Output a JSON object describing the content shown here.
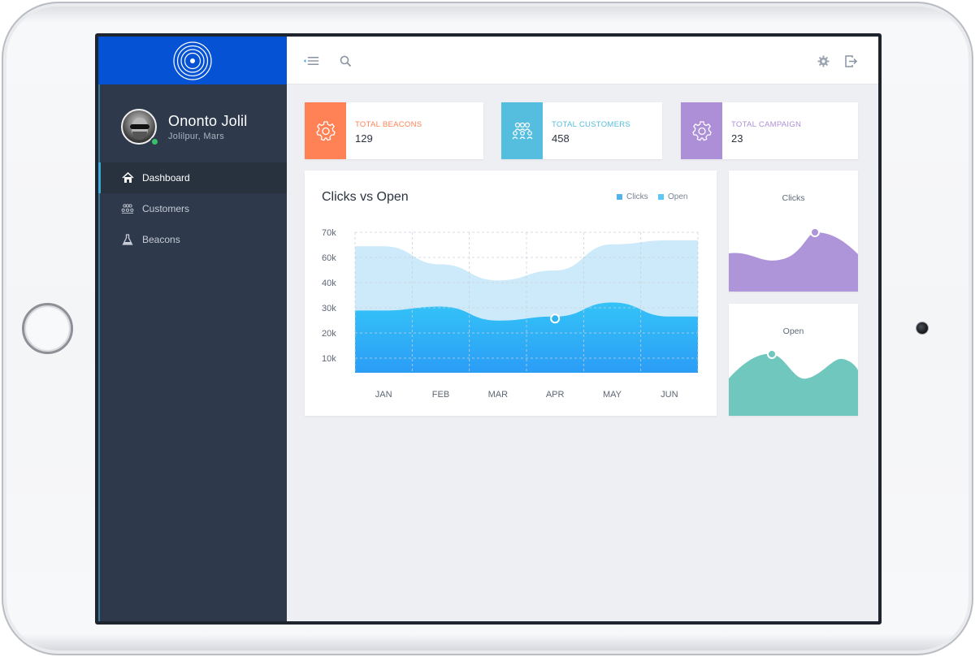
{
  "profile": {
    "name": "Ononto Jolil",
    "location": "Jolilpur, Mars"
  },
  "sidebar": {
    "items": [
      {
        "label": "Dashboard",
        "icon": "home-icon",
        "active": true
      },
      {
        "label": "Customers",
        "icon": "customers-icon",
        "active": false
      },
      {
        "label": "Beacons",
        "icon": "flask-icon",
        "active": false
      }
    ]
  },
  "topbar": {
    "icons": [
      "menu-collapse-icon",
      "search-icon",
      "gear-icon",
      "logout-icon"
    ]
  },
  "stats": [
    {
      "label": "TOTAL BEACONS",
      "value": "129",
      "color": "#ff8257",
      "icon": "gear-icon"
    },
    {
      "label": "TOTAL CUSTOMERS",
      "value": "458",
      "color": "#55bede",
      "icon": "customers-icon"
    },
    {
      "label": "TOTAL CAMPAIGN",
      "value": "23",
      "color": "#ad8fd8",
      "icon": "gear-icon"
    }
  ],
  "colors": {
    "brand_blue": "#0652d4",
    "sidebar": "#2e3a4c",
    "accent": "#38a9d8",
    "online": "#36c06a"
  },
  "main_chart": {
    "title": "Clicks vs Open",
    "legend": [
      {
        "label": "Clicks",
        "color": "#53b3ee"
      },
      {
        "label": "Open",
        "color": "#5ec7f6"
      }
    ]
  },
  "mini_charts": [
    {
      "title": "Clicks",
      "color": "#ae94d8"
    },
    {
      "title": "Open",
      "color": "#6fc7bd"
    }
  ],
  "chart_data": {
    "type": "area",
    "title": "Clicks vs Open",
    "categories": [
      "JAN",
      "FEB",
      "MAR",
      "APR",
      "MAY",
      "JUN"
    ],
    "y_ticks": [
      "70k",
      "60k",
      "40k",
      "30k",
      "20k",
      "10k"
    ],
    "ylim": [
      0,
      70000
    ],
    "grid": true,
    "legend_position": "top-right",
    "series": [
      {
        "name": "Clicks",
        "values": [
          63000,
          54000,
          46000,
          51000,
          64000,
          66000
        ]
      },
      {
        "name": "Open",
        "values": [
          31000,
          33000,
          26000,
          28000,
          35000,
          28000
        ]
      }
    ],
    "highlight_point": {
      "series": "Open",
      "category": "APR",
      "value": 27000
    }
  }
}
